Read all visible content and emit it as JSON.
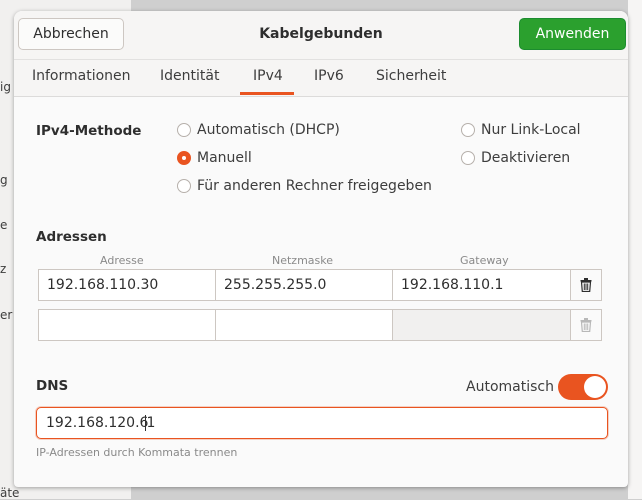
{
  "background": {
    "left_fragments": [
      "ig",
      "g",
      "e",
      "z",
      "er",
      "äte"
    ]
  },
  "dialog": {
    "cancel_label": "Abbrechen",
    "title": "Kabelgebunden",
    "apply_label": "Anwenden",
    "accent_color": "#e95420",
    "apply_color": "#2ba02e"
  },
  "tabs": [
    {
      "label": "Informationen",
      "active": false
    },
    {
      "label": "Identität",
      "active": false
    },
    {
      "label": "IPv4",
      "active": true
    },
    {
      "label": "IPv6",
      "active": false
    },
    {
      "label": "Sicherheit",
      "active": false
    }
  ],
  "ipv4_method": {
    "label": "IPv4-Methode",
    "options": [
      {
        "label": "Automatisch (DHCP)",
        "selected": false
      },
      {
        "label": "Nur Link-Local",
        "selected": false
      },
      {
        "label": "Manuell",
        "selected": true
      },
      {
        "label": "Deaktivieren",
        "selected": false
      },
      {
        "label": "Für anderen Rechner freigegeben",
        "selected": false
      }
    ]
  },
  "addresses": {
    "label": "Adressen",
    "headers": [
      "Adresse",
      "Netzmaske",
      "Gateway"
    ],
    "rows": [
      [
        "192.168.110.30",
        "255.255.255.0",
        "192.168.110.1"
      ],
      [
        "",
        "",
        ""
      ]
    ]
  },
  "dns": {
    "label": "DNS",
    "automatic_label": "Automatisch",
    "automatic_on": true,
    "value_before_caret": "192.168.120.6",
    "value_after_caret": "1",
    "hint": "IP-Adressen durch Kommata trennen"
  }
}
